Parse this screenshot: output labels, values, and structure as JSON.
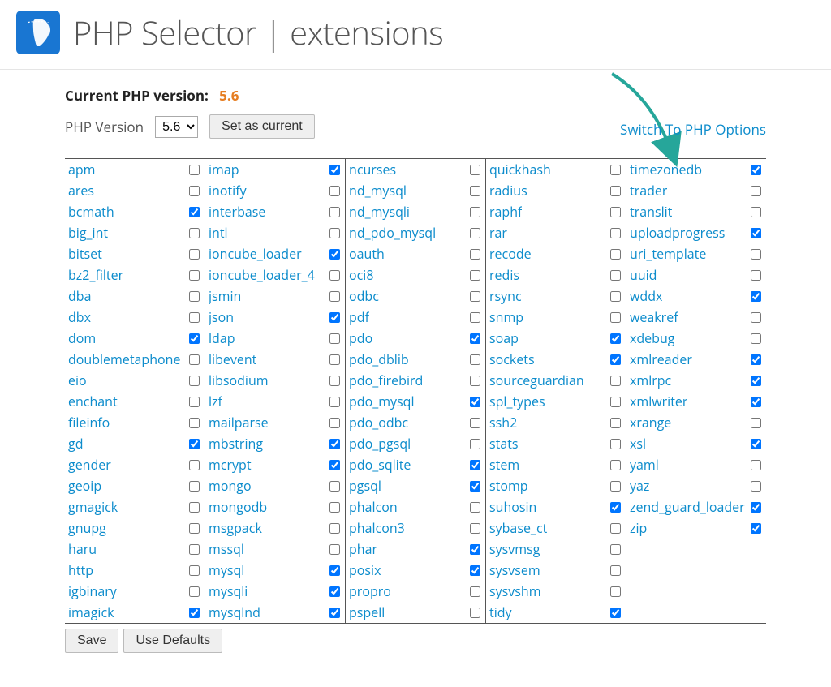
{
  "page_title": "PHP Selector | extensions",
  "current_version_label": "Current PHP version:",
  "current_version_value": "5.6",
  "version_label": "PHP Version",
  "version_select_value": "5.6",
  "set_as_current_label": "Set as current",
  "switch_link_label": "Switch To PHP Options",
  "save_label": "Save",
  "use_defaults_label": "Use Defaults",
  "columns": [
    [
      {
        "name": "apm",
        "checked": false
      },
      {
        "name": "ares",
        "checked": false
      },
      {
        "name": "bcmath",
        "checked": true
      },
      {
        "name": "big_int",
        "checked": false
      },
      {
        "name": "bitset",
        "checked": false
      },
      {
        "name": "bz2_filter",
        "checked": false
      },
      {
        "name": "dba",
        "checked": false
      },
      {
        "name": "dbx",
        "checked": false
      },
      {
        "name": "dom",
        "checked": true
      },
      {
        "name": "doublemetaphone",
        "checked": false
      },
      {
        "name": "eio",
        "checked": false
      },
      {
        "name": "enchant",
        "checked": false
      },
      {
        "name": "fileinfo",
        "checked": false
      },
      {
        "name": "gd",
        "checked": true
      },
      {
        "name": "gender",
        "checked": false
      },
      {
        "name": "geoip",
        "checked": false
      },
      {
        "name": "gmagick",
        "checked": false
      },
      {
        "name": "gnupg",
        "checked": false
      },
      {
        "name": "haru",
        "checked": false
      },
      {
        "name": "http",
        "checked": false
      },
      {
        "name": "igbinary",
        "checked": false
      },
      {
        "name": "imagick",
        "checked": true
      }
    ],
    [
      {
        "name": "imap",
        "checked": true
      },
      {
        "name": "inotify",
        "checked": false
      },
      {
        "name": "interbase",
        "checked": false
      },
      {
        "name": "intl",
        "checked": false
      },
      {
        "name": "ioncube_loader",
        "checked": true
      },
      {
        "name": "ioncube_loader_4",
        "checked": false
      },
      {
        "name": "jsmin",
        "checked": false
      },
      {
        "name": "json",
        "checked": true
      },
      {
        "name": "ldap",
        "checked": false
      },
      {
        "name": "libevent",
        "checked": false
      },
      {
        "name": "libsodium",
        "checked": false
      },
      {
        "name": "lzf",
        "checked": false
      },
      {
        "name": "mailparse",
        "checked": false
      },
      {
        "name": "mbstring",
        "checked": true
      },
      {
        "name": "mcrypt",
        "checked": true
      },
      {
        "name": "mongo",
        "checked": false
      },
      {
        "name": "mongodb",
        "checked": false
      },
      {
        "name": "msgpack",
        "checked": false
      },
      {
        "name": "mssql",
        "checked": false
      },
      {
        "name": "mysql",
        "checked": true
      },
      {
        "name": "mysqli",
        "checked": true
      },
      {
        "name": "mysqlnd",
        "checked": true
      }
    ],
    [
      {
        "name": "ncurses",
        "checked": false
      },
      {
        "name": "nd_mysql",
        "checked": false
      },
      {
        "name": "nd_mysqli",
        "checked": false
      },
      {
        "name": "nd_pdo_mysql",
        "checked": false
      },
      {
        "name": "oauth",
        "checked": false
      },
      {
        "name": "oci8",
        "checked": false
      },
      {
        "name": "odbc",
        "checked": false
      },
      {
        "name": "pdf",
        "checked": false
      },
      {
        "name": "pdo",
        "checked": true
      },
      {
        "name": "pdo_dblib",
        "checked": false
      },
      {
        "name": "pdo_firebird",
        "checked": false
      },
      {
        "name": "pdo_mysql",
        "checked": true
      },
      {
        "name": "pdo_odbc",
        "checked": false
      },
      {
        "name": "pdo_pgsql",
        "checked": false
      },
      {
        "name": "pdo_sqlite",
        "checked": true
      },
      {
        "name": "pgsql",
        "checked": true
      },
      {
        "name": "phalcon",
        "checked": false
      },
      {
        "name": "phalcon3",
        "checked": false
      },
      {
        "name": "phar",
        "checked": true
      },
      {
        "name": "posix",
        "checked": true
      },
      {
        "name": "propro",
        "checked": false
      },
      {
        "name": "pspell",
        "checked": false
      }
    ],
    [
      {
        "name": "quickhash",
        "checked": false
      },
      {
        "name": "radius",
        "checked": false
      },
      {
        "name": "raphf",
        "checked": false
      },
      {
        "name": "rar",
        "checked": false
      },
      {
        "name": "recode",
        "checked": false
      },
      {
        "name": "redis",
        "checked": false
      },
      {
        "name": "rsync",
        "checked": false
      },
      {
        "name": "snmp",
        "checked": false
      },
      {
        "name": "soap",
        "checked": true
      },
      {
        "name": "sockets",
        "checked": true
      },
      {
        "name": "sourceguardian",
        "checked": false
      },
      {
        "name": "spl_types",
        "checked": false
      },
      {
        "name": "ssh2",
        "checked": false
      },
      {
        "name": "stats",
        "checked": false
      },
      {
        "name": "stem",
        "checked": false
      },
      {
        "name": "stomp",
        "checked": false
      },
      {
        "name": "suhosin",
        "checked": true
      },
      {
        "name": "sybase_ct",
        "checked": false
      },
      {
        "name": "sysvmsg",
        "checked": false
      },
      {
        "name": "sysvsem",
        "checked": false
      },
      {
        "name": "sysvshm",
        "checked": false
      },
      {
        "name": "tidy",
        "checked": true
      }
    ],
    [
      {
        "name": "timezonedb",
        "checked": true
      },
      {
        "name": "trader",
        "checked": false
      },
      {
        "name": "translit",
        "checked": false
      },
      {
        "name": "uploadprogress",
        "checked": true
      },
      {
        "name": "uri_template",
        "checked": false
      },
      {
        "name": "uuid",
        "checked": false
      },
      {
        "name": "wddx",
        "checked": true
      },
      {
        "name": "weakref",
        "checked": false
      },
      {
        "name": "xdebug",
        "checked": false
      },
      {
        "name": "xmlreader",
        "checked": true
      },
      {
        "name": "xmlrpc",
        "checked": true
      },
      {
        "name": "xmlwriter",
        "checked": true
      },
      {
        "name": "xrange",
        "checked": false
      },
      {
        "name": "xsl",
        "checked": true
      },
      {
        "name": "yaml",
        "checked": false
      },
      {
        "name": "yaz",
        "checked": false
      },
      {
        "name": "zend_guard_loader",
        "checked": true
      },
      {
        "name": "zip",
        "checked": true
      }
    ]
  ]
}
